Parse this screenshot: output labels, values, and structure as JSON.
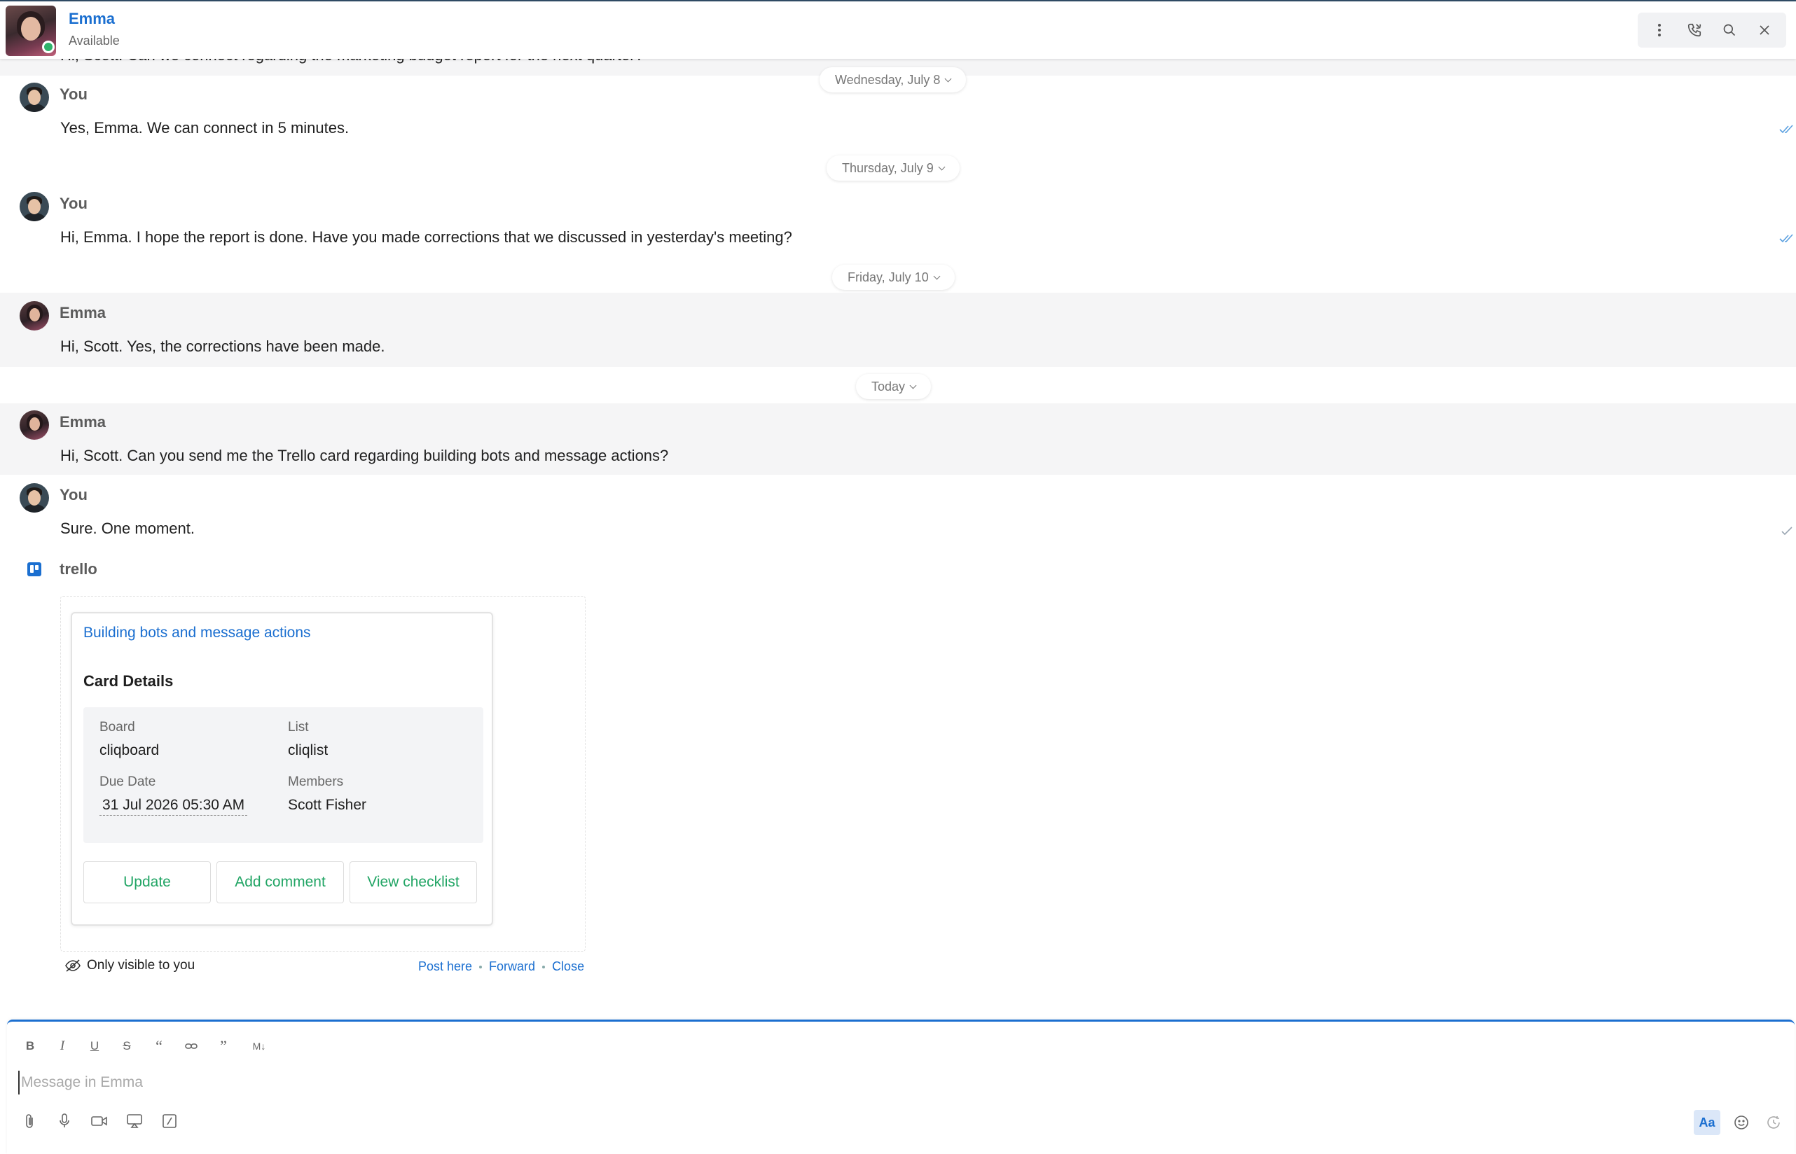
{
  "header": {
    "name": "Emma",
    "status": "Available",
    "tools": [
      "more-options-icon",
      "call-icon",
      "search-icon",
      "close-icon"
    ]
  },
  "chat": {
    "partial_message": "Hi, Scott. Can we connect regarding the marketing budget report for the next quarter?",
    "separators": [
      "Wednesday, July 8",
      "Thursday, July 9",
      "Friday, July 10",
      "Today"
    ],
    "messages": [
      {
        "sender": "You",
        "text": "Yes, Emma. We can connect in 5 minutes.",
        "status": "read"
      },
      {
        "sender": "You",
        "text": "Hi, Emma. I hope the report is done. Have you made corrections that we discussed in yesterday's meeting?",
        "status": "read"
      },
      {
        "sender": "Emma",
        "text": "Hi, Scott. Yes, the corrections have been made."
      },
      {
        "sender": "Emma",
        "text": "Hi, Scott. Can you send me the Trello card regarding building bots and message actions?"
      },
      {
        "sender": "You",
        "text": "Sure. One moment.",
        "status": "sent"
      }
    ]
  },
  "trello": {
    "sender": "trello",
    "card_link": "Building bots and message actions",
    "card_title": "Card Details",
    "board_label": "Board",
    "board_value": "cliqboard",
    "list_label": "List",
    "list_value": "cliqlist",
    "due_label": "Due Date",
    "due_value": "31 Jul 2026 05:30 AM",
    "members_label": "Members",
    "members_value": "Scott Fisher",
    "buttons": [
      "Update",
      "Add comment",
      "View checklist"
    ],
    "visibility": "Only visible to you",
    "actions": [
      "Post here",
      "Forward",
      "Close"
    ]
  },
  "composer": {
    "placeholder": "Message in Emma",
    "format_tools": [
      "bold-icon",
      "italic-icon",
      "underline-icon",
      "strikethrough-icon",
      "quote-icon",
      "link-icon",
      "blockquote-icon",
      "markdown-icon"
    ],
    "aa_label": "Aa"
  },
  "colors": {
    "accent": "#1b6fd0",
    "action_green": "#22a565",
    "online": "#2fb36b",
    "highlight_row": "#f5f5f6"
  }
}
